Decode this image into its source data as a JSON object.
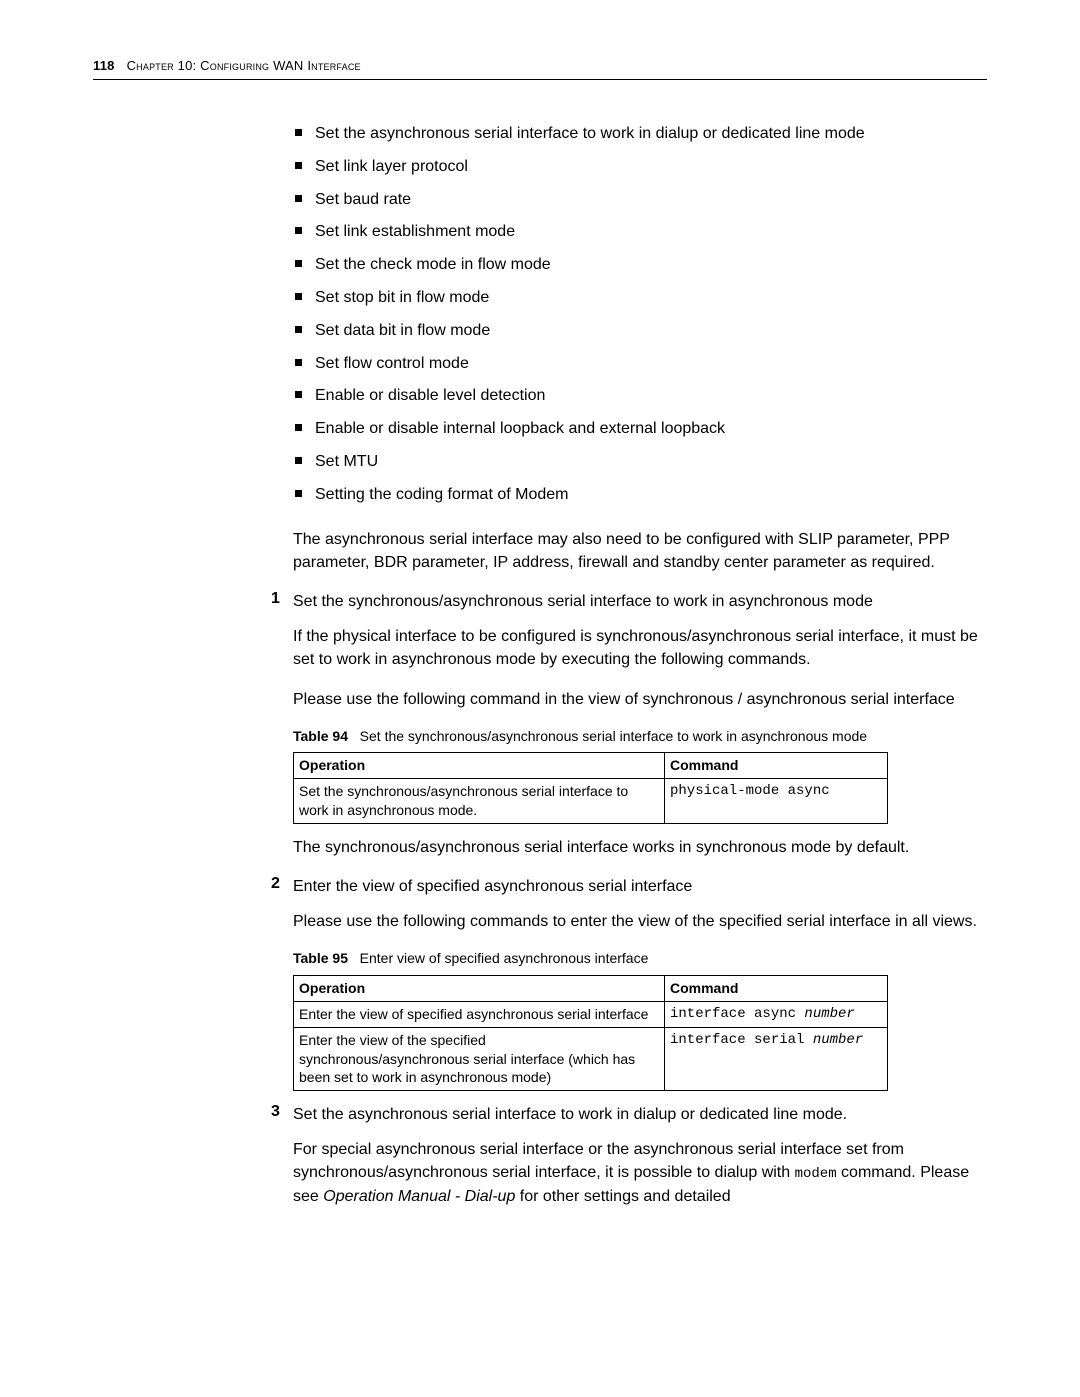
{
  "header": {
    "page_number": "118",
    "chapter_label": "Chapter 10: Configuring WAN Interface"
  },
  "bullets": [
    "Set the asynchronous serial interface to work in dialup or dedicated line mode",
    "Set link layer protocol",
    "Set baud rate",
    "Set link establishment mode",
    "Set the check mode in flow mode",
    "Set stop bit in flow mode",
    "Set data bit in flow mode",
    "Set flow control mode",
    "Enable or disable level detection",
    "Enable or disable internal loopback and external loopback",
    "Set MTU",
    "Setting the coding format of Modem"
  ],
  "intro_para": "The asynchronous serial interface may also need to be configured with SLIP parameter, PPP parameter, BDR parameter, IP address, firewall and standby center parameter as required.",
  "step1": {
    "num": "1",
    "title": "Set the synchronous/asynchronous serial interface to work in asynchronous mode",
    "p1": "If the physical interface to be configured is synchronous/asynchronous serial interface, it must be set to work in asynchronous mode by executing the following commands.",
    "p2": "Please use the following command in the view of synchronous / asynchronous serial interface",
    "table_caption_name": "Table 94",
    "table_caption_text": "Set the synchronous/asynchronous serial interface to work in asynchronous mode",
    "table_headers": {
      "op": "Operation",
      "cmd": "Command"
    },
    "row": {
      "op": "Set the synchronous/asynchronous serial interface to work in asynchronous mode.",
      "cmd": "physical-mode async"
    },
    "after": "The synchronous/asynchronous serial interface works in synchronous mode by default."
  },
  "step2": {
    "num": "2",
    "title": "Enter the view of specified asynchronous serial interface",
    "p1": "Please use the following commands to enter the view of the specified serial interface in all views.",
    "table_caption_name": "Table 95",
    "table_caption_text": "Enter view of specified asynchronous interface",
    "table_headers": {
      "op": "Operation",
      "cmd": "Command"
    },
    "row1": {
      "op": "Enter the view of specified asynchronous serial interface",
      "cmd_prefix": "interface async ",
      "cmd_arg": "number"
    },
    "row2": {
      "op": "Enter the view of the specified synchronous/asynchronous serial interface (which has been set to work in asynchronous mode)",
      "cmd_prefix": "interface serial ",
      "cmd_arg": "number"
    }
  },
  "step3": {
    "num": "3",
    "title": "Set the asynchronous serial interface to work in dialup or dedicated line mode.",
    "p_pre": "For special asynchronous serial interface or the asynchronous serial interface set from synchronous/asynchronous serial interface, it is possible to dialup with ",
    "p_cmd": "modem",
    "p_mid": " command. Please see ",
    "p_ital": "Operation Manual - Dial-up",
    "p_post": " for other settings and detailed"
  }
}
